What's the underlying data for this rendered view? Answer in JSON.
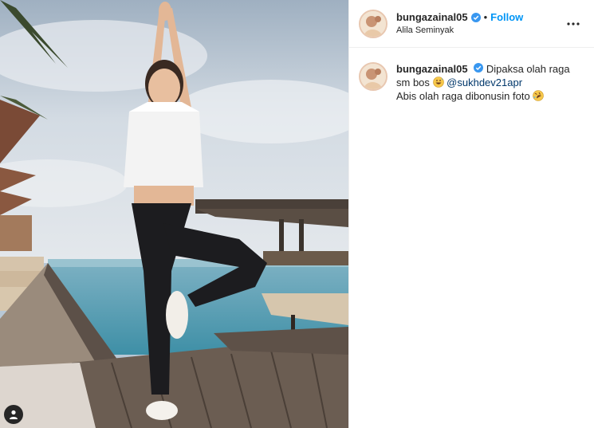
{
  "post": {
    "username": "bungazainal05",
    "dot": "•",
    "follow_label": "Follow",
    "location": "Alila Seminyak",
    "more_label": "···",
    "caption": {
      "text_1": "Dipaksa olah raga sm bos",
      "mention": "@sukhdev21apr",
      "text_2": "Abis olah raga dibonusin foto"
    }
  },
  "colors": {
    "accent": "#0095f6",
    "verified": "#3897f0",
    "mention": "#00376b"
  },
  "icons": [
    "verified-badge-icon",
    "more-options-icon",
    "user-tag-icon",
    "grinning-sweat-emoji",
    "rolling-laughing-emoji"
  ]
}
